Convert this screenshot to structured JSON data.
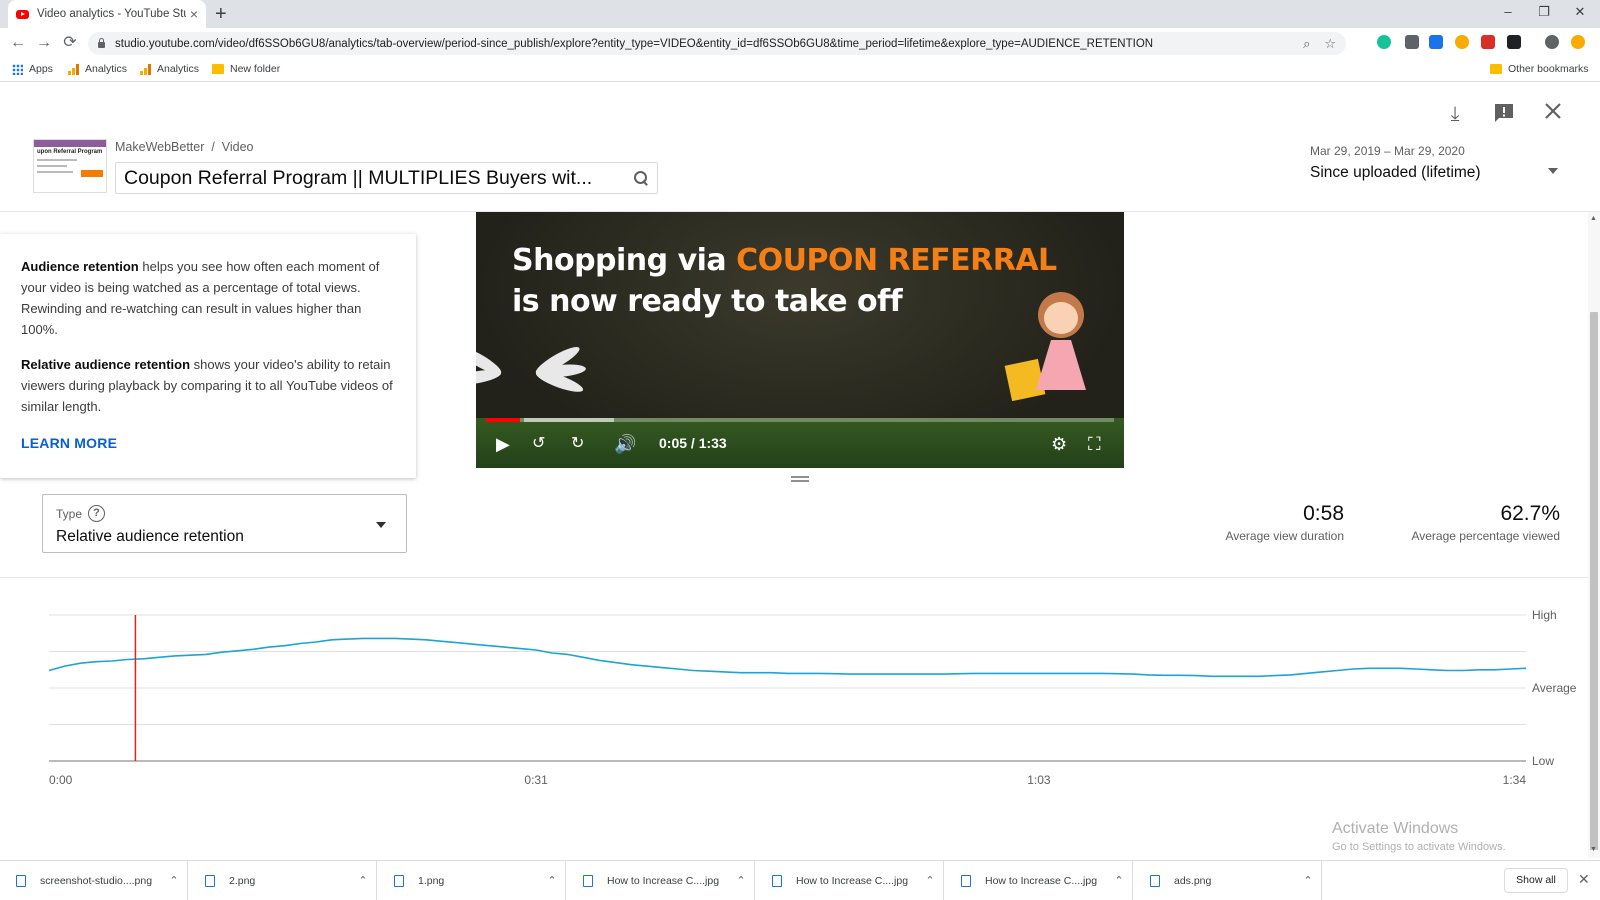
{
  "browser": {
    "tab_title": "Video analytics - YouTube Studio",
    "tab_close": "×",
    "new_tab": "+",
    "window_controls": [
      "–",
      "❐",
      "✕"
    ],
    "url": "studio.youtube.com/video/df6SSOb6GU8/analytics/tab-overview/period-since_publish/explore?entity_type=VIDEO&entity_id=df6SSOb6GU8&time_period=lifetime&explore_type=AUDIENCE_RETENTION",
    "nav": {
      "back": "←",
      "forward": "→",
      "reload": "⟳"
    },
    "bookmarks": [
      "Apps",
      "Analytics",
      "Analytics",
      "New folder"
    ],
    "other_bookmarks": "Other bookmarks"
  },
  "header": {
    "breadcrumb": "MakeWebBetter  /  Video",
    "video_title": "Coupon Referral Program || MULTIPLIES Buyers wit...",
    "thumb_text": "upon Referral Program",
    "date_range": "Mar 29, 2019 – Mar 29, 2020",
    "period": "Since uploaded (lifetime)",
    "icons": [
      "download-icon",
      "feedback-icon",
      "close-icon"
    ]
  },
  "player": {
    "headline_line1": "Shopping via ",
    "headline_accent": "COUPON REFERRAL",
    "headline_line2": "is now ready to take off",
    "timecode": "0:05 / 1:33",
    "progress_fraction": 0.054
  },
  "info": {
    "p1_bold": "Audience retention",
    "p1_text": " helps you see how often each moment of your video is being watched as a percentage of total views. Rewinding and re-watching can result in values higher than 100%.",
    "p2_bold": "Relative audience retention",
    "p2_text": " shows your video's ability to retain viewers during playback by comparing it to all YouTube videos of similar length.",
    "learn_more": "LEARN MORE"
  },
  "type_select": {
    "label": "Type",
    "help": "?",
    "value": "Relative audience retention"
  },
  "metrics": [
    {
      "value": "0:58",
      "label": "Average view duration"
    },
    {
      "value": "62.7%",
      "label": "Average percentage viewed"
    }
  ],
  "chart_data": {
    "type": "line",
    "title": "",
    "xlabel": "",
    "ylabel": "",
    "x_ticks": [
      "0:00",
      "0:31",
      "1:03",
      "1:34"
    ],
    "x_tick_seconds": [
      0,
      31,
      63,
      94
    ],
    "y_ticks": [
      "Low",
      "Average",
      "High"
    ],
    "ylim": [
      0,
      1
    ],
    "grid": true,
    "color": "#1ea2d8",
    "marker_x_seconds": 5.5,
    "marker_color": "#e62117",
    "x": [
      0,
      1,
      2,
      3,
      4,
      5,
      6,
      7,
      8,
      9,
      10,
      11,
      12,
      13,
      14,
      15,
      16,
      17,
      18,
      19,
      20,
      21,
      22,
      23,
      24,
      25,
      26,
      27,
      28,
      29,
      30,
      31,
      32,
      33,
      34,
      35,
      36,
      37,
      38,
      39,
      40,
      41,
      42,
      43,
      44,
      45,
      46,
      47,
      48,
      49,
      50,
      51,
      52,
      53,
      54,
      55,
      56,
      57,
      58,
      59,
      60,
      61,
      62,
      63,
      64,
      65,
      66,
      67,
      68,
      69,
      70,
      71,
      72,
      73,
      74,
      75,
      76,
      77,
      78,
      79,
      80,
      81,
      82,
      83,
      84,
      85,
      86,
      87,
      88,
      89,
      90,
      91,
      92,
      93,
      94
    ],
    "values": [
      0.62,
      0.65,
      0.67,
      0.68,
      0.685,
      0.695,
      0.7,
      0.71,
      0.72,
      0.725,
      0.73,
      0.745,
      0.755,
      0.765,
      0.78,
      0.79,
      0.805,
      0.815,
      0.83,
      0.835,
      0.84,
      0.84,
      0.84,
      0.835,
      0.83,
      0.82,
      0.81,
      0.8,
      0.79,
      0.78,
      0.77,
      0.76,
      0.74,
      0.73,
      0.71,
      0.69,
      0.675,
      0.66,
      0.65,
      0.64,
      0.63,
      0.62,
      0.615,
      0.61,
      0.605,
      0.605,
      0.605,
      0.6,
      0.6,
      0.6,
      0.598,
      0.595,
      0.595,
      0.595,
      0.595,
      0.595,
      0.595,
      0.595,
      0.598,
      0.6,
      0.6,
      0.6,
      0.6,
      0.6,
      0.6,
      0.6,
      0.6,
      0.6,
      0.598,
      0.595,
      0.59,
      0.587,
      0.587,
      0.585,
      0.58,
      0.58,
      0.58,
      0.58,
      0.585,
      0.59,
      0.6,
      0.61,
      0.62,
      0.63,
      0.635,
      0.635,
      0.635,
      0.63,
      0.625,
      0.62,
      0.62,
      0.625,
      0.625,
      0.63,
      0.635
    ]
  },
  "watermark": {
    "line1": "Activate Windows",
    "line2": "Go to Settings to activate Windows."
  },
  "downloads": {
    "items": [
      "screenshot-studio....png",
      "2.png",
      "1.png",
      "How to Increase C....jpg",
      "How to Increase C....jpg",
      "How to Increase C....jpg",
      "ads.png"
    ],
    "show_all": "Show all",
    "close": "✕"
  }
}
